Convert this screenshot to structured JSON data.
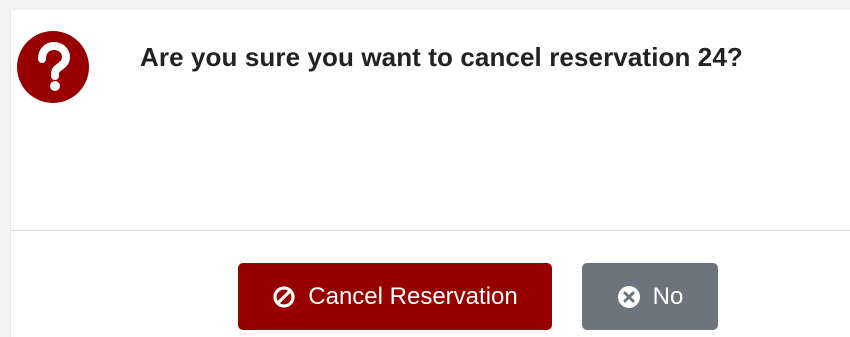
{
  "dialog": {
    "message": "Are you sure you want to cancel reservation 24?",
    "icon": "question-circle-icon",
    "accent_color": "#980000"
  },
  "buttons": {
    "cancel_reservation": {
      "label": "Cancel Reservation",
      "icon": "ban-icon",
      "color": "#980000"
    },
    "no": {
      "label": "No",
      "icon": "times-circle-icon",
      "color": "#6c757d"
    }
  }
}
